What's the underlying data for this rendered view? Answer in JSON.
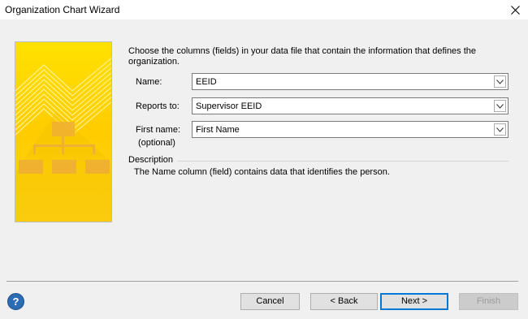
{
  "window": {
    "title": "Organization Chart Wizard",
    "close_icon": "close-icon"
  },
  "main": {
    "intro": "Choose the columns (fields) in your data file that contain the information that defines the organization.",
    "fields": [
      {
        "label": "Name:",
        "value": "EEID"
      },
      {
        "label": "Reports to:",
        "value": "Supervisor EEID"
      },
      {
        "label": "First name:",
        "label2": "(optional)",
        "value": "First Name"
      }
    ],
    "description": {
      "heading": "Description",
      "text": "The Name column (field) contains data that identifies the person."
    }
  },
  "footer": {
    "help_icon": "help-icon",
    "help_glyph": "?",
    "cancel": "Cancel",
    "back": "< Back",
    "next": "Next >",
    "finish": "Finish"
  },
  "colors": {
    "banner_yellow": "#ffd400",
    "accent_blue": "#0078d7"
  }
}
